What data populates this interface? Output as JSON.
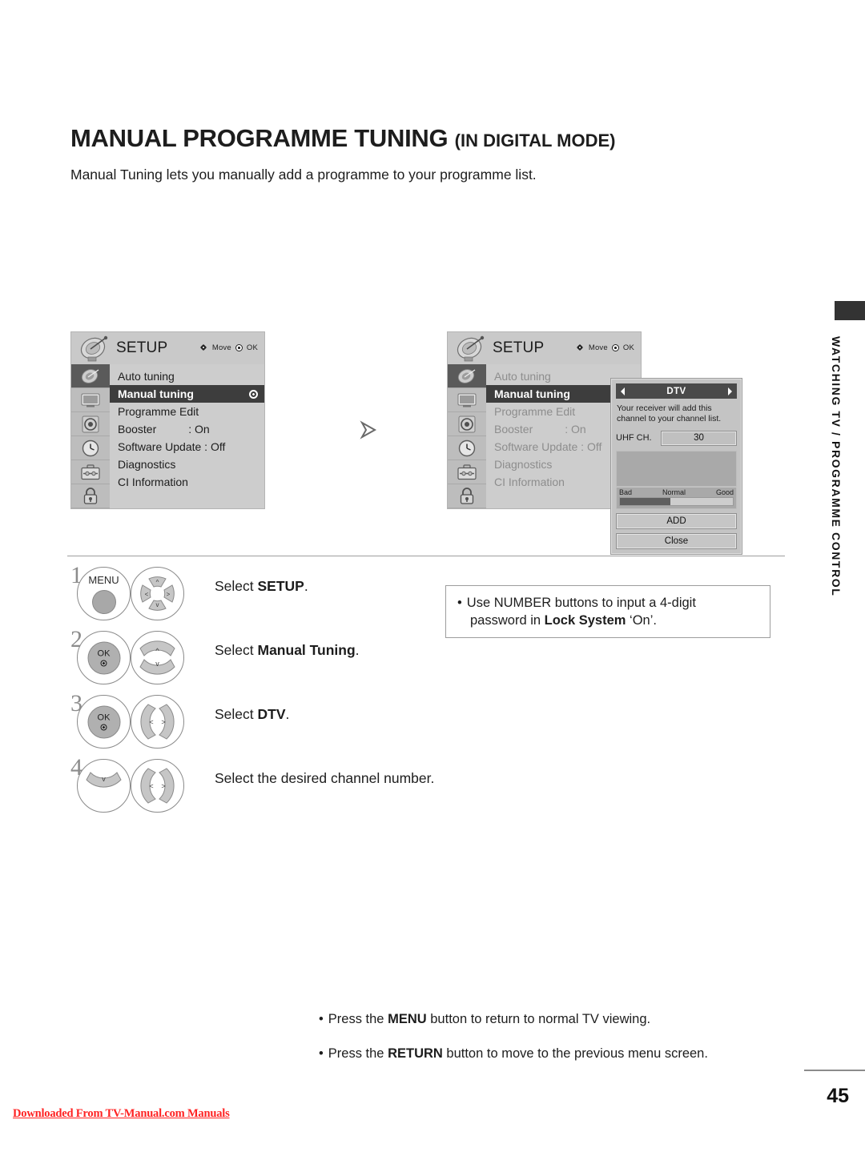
{
  "header": {
    "title_main": "MANUAL PROGRAMME TUNING",
    "title_sub": "(IN DIGITAL MODE)",
    "intro": "Manual Tuning lets you manually add a programme to your programme list."
  },
  "osd": {
    "title": "SETUP",
    "hint_move": "Move",
    "hint_ok": "OK",
    "rail_icons": [
      "satellite-dish-icon",
      "picture-tv-icon",
      "audio-speaker-icon",
      "clock-icon",
      "options-toolbox-icon",
      "lock-icon"
    ],
    "items": [
      {
        "label": "Auto tuning",
        "value": ""
      },
      {
        "label": "Manual tuning",
        "value": "",
        "highlighted": true,
        "radio": true
      },
      {
        "label": "Programme Edit",
        "value": ""
      },
      {
        "label": "Booster",
        "value": ": On"
      },
      {
        "label": "Software Update : Off",
        "value": ""
      },
      {
        "label": "Diagnostics",
        "value": ""
      },
      {
        "label": "CI Information",
        "value": ""
      }
    ]
  },
  "dtv_dialog": {
    "title": "DTV",
    "left_arrow": "prev-arrow-icon",
    "right_arrow": "next-arrow-icon",
    "description": "Your receiver will add this channel to your channel list.",
    "field_label": "UHF CH.",
    "field_value": "30",
    "meter": {
      "bad": "Bad",
      "normal": "Normal",
      "good": "Good",
      "fill_percent": 45
    },
    "add_button": "ADD",
    "close_button": "Close"
  },
  "steps": [
    {
      "num": "1",
      "button_label": "MENU",
      "pad": "four-way",
      "text_prefix": "Select ",
      "text_bold": "SETUP",
      "text_suffix": "."
    },
    {
      "num": "2",
      "button_label": "OK",
      "pad": "up-down",
      "text_prefix": "Select ",
      "text_bold": "Manual Tuning",
      "text_suffix": "."
    },
    {
      "num": "3",
      "button_label": "OK",
      "pad": "left-right",
      "text_prefix": "Select ",
      "text_bold": "DTV",
      "text_suffix": "."
    },
    {
      "num": "4",
      "button_label": "",
      "pad": "left-right",
      "text_prefix": "Select the desired channel number.",
      "text_bold": "",
      "text_suffix": ""
    }
  ],
  "note_box": {
    "bullet": "•",
    "line1": "Use NUMBER buttons to input a 4-digit",
    "line2_prefix": "password in ",
    "line2_bold": "Lock System",
    "line2_suffix": " ‘On’."
  },
  "bottom_notes": [
    {
      "bullet": "•",
      "prefix": "Press the ",
      "bold": "MENU",
      "suffix": " button to return to normal TV viewing."
    },
    {
      "bullet": "•",
      "prefix": "Press the ",
      "bold": "RETURN",
      "suffix": " button to move to the previous menu screen."
    }
  ],
  "side_tab": {
    "text": "WATCHING TV / PROGRAMME CONTROL"
  },
  "footer": {
    "page_number": "45",
    "download_text": "Downloaded From TV-Manual.com Manuals"
  }
}
